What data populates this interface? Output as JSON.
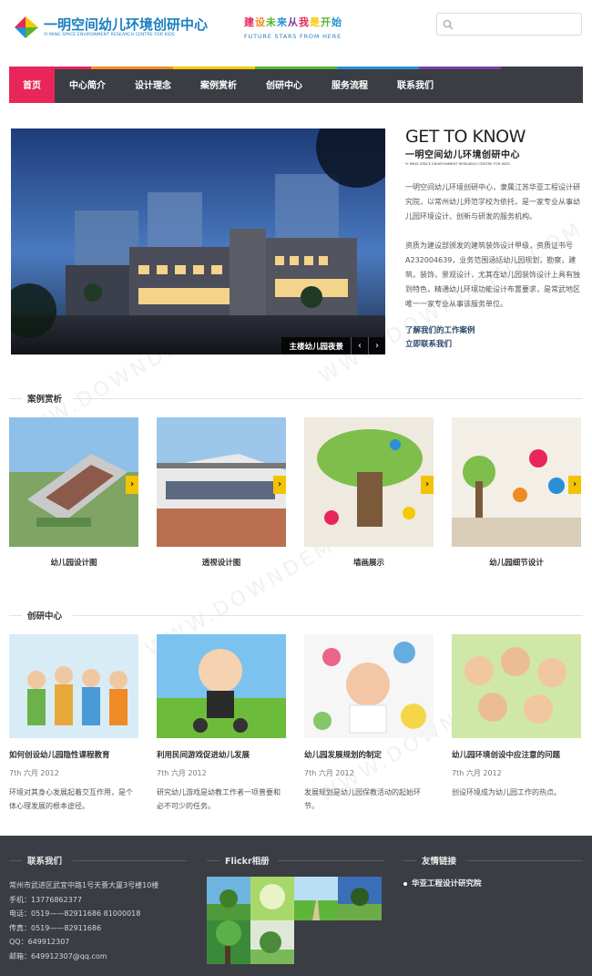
{
  "header": {
    "logo_title": "一明空间幼儿环境创研中心",
    "logo_subtitle": "YI MING SPACE ENVIRONMENT RESEARCH CENTRE FOR KIDS",
    "slogan_cn": [
      "建",
      "设",
      "未",
      "来",
      " ",
      "从",
      "我",
      "是",
      "开",
      "始"
    ],
    "slogan_en": "FUTURE STARS FROM HERE",
    "search_placeholder": ""
  },
  "nav": {
    "items": [
      {
        "label": "首页",
        "active": true
      },
      {
        "label": "中心简介",
        "active": false
      },
      {
        "label": "设计理念",
        "active": false
      },
      {
        "label": "案例赏析",
        "active": false
      },
      {
        "label": "创研中心",
        "active": false
      },
      {
        "label": "服务流程",
        "active": false
      },
      {
        "label": "联系我们",
        "active": false
      }
    ],
    "strip_colors": [
      "#e8265a",
      "#f08a24",
      "#f6c900",
      "#59b231",
      "#2a8fd6",
      "#7b3fa0",
      "#3a3d44"
    ]
  },
  "intro": {
    "hero_caption": "主楼幼儿园夜景",
    "hero_prev": "‹",
    "hero_next": "›",
    "gtk_title": "GET TO KNOW",
    "gtk_subtitle": "一明空间幼儿环境创研中心",
    "gtk_subtitle_en": "YI MING SPACE ENVIRONMENT RESEARCH CENTRE FOR KIDS",
    "paragraph1": "一明空间幼儿环境创研中心，隶属江苏华亚工程设计研究院，以常州幼儿师范学校为依托，是一家专业从事幼儿园环境设计、创新与研发的服务机构。",
    "paragraph2": "资质为建设部颁发的建筑装饰设计甲级，资质证书号 A232004639，业务范围涵括幼儿园规划，勘察，建筑，装饰，景观设计，尤其在幼儿园装饰设计上具有独到特色，精通幼儿环境功能设计布置要求，是常武地区唯一一家专业从事该服务单位。",
    "link1": "了解我们的工作案例",
    "link2": "立即联系我们"
  },
  "cases": {
    "heading": "案例赏析",
    "items": [
      {
        "label": "幼儿园设计图",
        "arrow": "›"
      },
      {
        "label": "透视设计图",
        "arrow": "›"
      },
      {
        "label": "墙画展示",
        "arrow": "›"
      },
      {
        "label": "幼儿园细节设计",
        "arrow": "›"
      }
    ]
  },
  "research": {
    "heading": "创研中心",
    "items": [
      {
        "title": "如何创设幼儿园隐性课程教育",
        "date": "7th 六月 2012",
        "desc": "环境对其身心发展起着交互作用，是个体心理发展的根本途径。"
      },
      {
        "title": "利用民间游戏促进幼儿发展",
        "date": "7th 六月 2012",
        "desc": "研究幼儿游戏是幼教工作者一项普要和必不可少的任务。"
      },
      {
        "title": "幼儿园发展规划的制定",
        "date": "7th 六月 2012",
        "desc": "发展规划是幼儿园保教活动的起始环节。"
      },
      {
        "title": "幼儿园环境创设中应注意的问题",
        "date": "7th 六月 2012",
        "desc": "创设环境成为幼儿园工作的热点。"
      }
    ]
  },
  "footer": {
    "contact_heading": "联系我们",
    "contact_lines": [
      "常州市武进区武宜中路1号天薈大厦3号楼10楼",
      "手机：13776862377",
      "电话：0519——82911686 81000018",
      "传真：0519——82911686",
      "QQ：649912307",
      "邮箱：649912307@qq.com"
    ],
    "flickr_heading": "Flickr相册",
    "links_heading": "友情链接",
    "links": [
      "华亚工程设计研究院"
    ]
  },
  "watermark": "WWW.DOWNDEMO.COM"
}
